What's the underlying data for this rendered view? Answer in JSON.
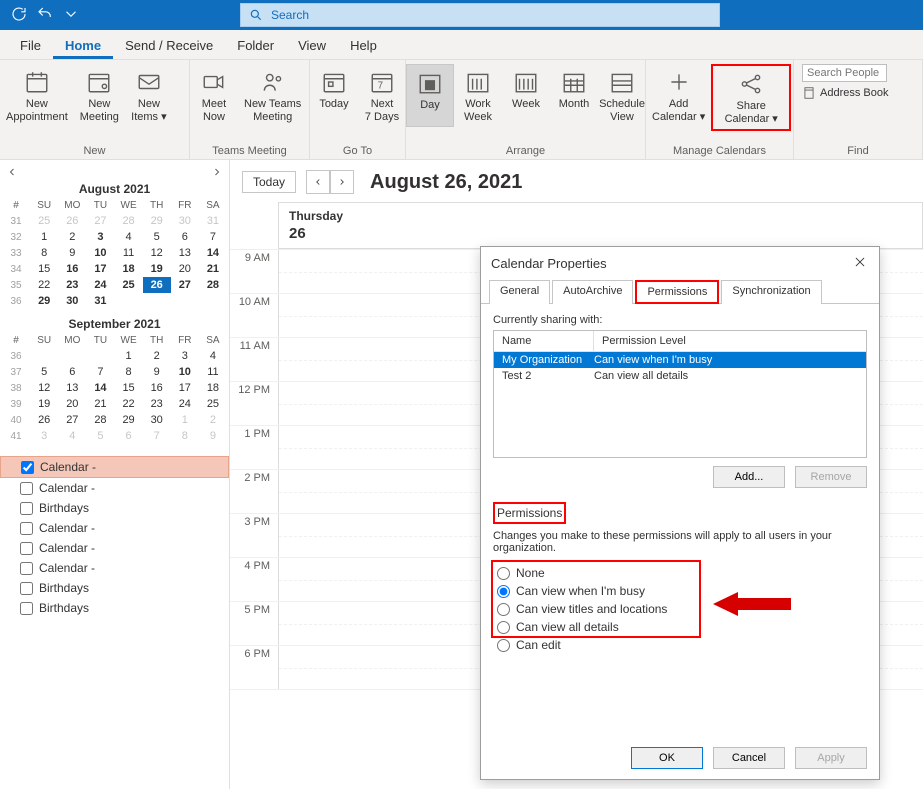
{
  "titlebar": {
    "search_placeholder": "Search"
  },
  "menubar": {
    "file": "File",
    "home": "Home",
    "sendreceive": "Send / Receive",
    "folder": "Folder",
    "view": "View",
    "help": "Help"
  },
  "ribbon": {
    "new_appt": "New\nAppointment",
    "new_meeting": "New\nMeeting",
    "new_items": "New\nItems ▾",
    "meet_now": "Meet\nNow",
    "new_teams": "New Teams\nMeeting",
    "today": "Today",
    "next7": "Next\n7 Days",
    "day": "Day",
    "workweek": "Work\nWeek",
    "week": "Week",
    "month": "Month",
    "schedule": "Schedule\nView",
    "add_cal": "Add\nCalendar ▾",
    "share_cal": "Share\nCalendar ▾",
    "search_people_ph": "Search People",
    "address_book": "Address Book",
    "group_new": "New",
    "group_teams": "Teams Meeting",
    "group_goto": "Go To",
    "group_arrange": "Arrange",
    "group_manage": "Manage Calendars",
    "group_find": "Find"
  },
  "calendars": {
    "aug_title": "August 2021",
    "sep_title": "September 2021",
    "dow": [
      "#",
      "SU",
      "MO",
      "TU",
      "WE",
      "TH",
      "FR",
      "SA"
    ],
    "aug_rows": [
      {
        "wk": "31",
        "d": [
          "25",
          "26",
          "27",
          "28",
          "29",
          "30",
          "31"
        ],
        "prev": true,
        "bold": []
      },
      {
        "wk": "32",
        "d": [
          "1",
          "2",
          "3",
          "4",
          "5",
          "6",
          "7"
        ],
        "bold": [
          "3"
        ]
      },
      {
        "wk": "33",
        "d": [
          "8",
          "9",
          "10",
          "11",
          "12",
          "13",
          "14"
        ],
        "bold": [
          "10",
          "14"
        ]
      },
      {
        "wk": "34",
        "d": [
          "15",
          "16",
          "17",
          "18",
          "19",
          "20",
          "21"
        ],
        "bold": [
          "16",
          "17",
          "18",
          "19",
          "21"
        ]
      },
      {
        "wk": "35",
        "d": [
          "22",
          "23",
          "24",
          "25",
          "26",
          "27",
          "28"
        ],
        "bold": [
          "23",
          "24",
          "25",
          "26",
          "27",
          "28"
        ],
        "today": "26"
      },
      {
        "wk": "36",
        "d": [
          "29",
          "30",
          "31",
          "",
          "",
          "",
          ""
        ],
        "bold": [
          "29",
          "30",
          "31"
        ]
      }
    ],
    "sep_rows": [
      {
        "wk": "36",
        "d": [
          "",
          "",
          "",
          "1",
          "2",
          "3",
          "4"
        ],
        "bold": []
      },
      {
        "wk": "37",
        "d": [
          "5",
          "6",
          "7",
          "8",
          "9",
          "10",
          "11"
        ],
        "bold": [
          "10"
        ]
      },
      {
        "wk": "38",
        "d": [
          "12",
          "13",
          "14",
          "15",
          "16",
          "17",
          "18"
        ],
        "bold": [
          "14"
        ]
      },
      {
        "wk": "39",
        "d": [
          "19",
          "20",
          "21",
          "22",
          "23",
          "24",
          "25"
        ],
        "bold": []
      },
      {
        "wk": "40",
        "d": [
          "26",
          "27",
          "28",
          "29",
          "30",
          "1",
          "2"
        ],
        "bold": [],
        "nprev": [
          "1",
          "2"
        ]
      },
      {
        "wk": "41",
        "d": [
          "3",
          "4",
          "5",
          "6",
          "7",
          "8",
          "9"
        ],
        "prev": true,
        "bold": []
      }
    ],
    "list": [
      "Calendar -",
      "Calendar -",
      "Birthdays",
      "Calendar -",
      "Calendar -",
      "Calendar -",
      "Birthdays",
      "Birthdays"
    ]
  },
  "main": {
    "today_btn": "Today",
    "date_title": "August 26, 2021",
    "day_name": "Thursday",
    "day_num": "26",
    "hours": [
      "9 AM",
      "10 AM",
      "11 AM",
      "12 PM",
      "1 PM",
      "2 PM",
      "3 PM",
      "4 PM",
      "5 PM",
      "6 PM"
    ]
  },
  "dialog": {
    "title": "Calendar Properties",
    "tabs": {
      "general": "General",
      "auto": "AutoArchive",
      "perm": "Permissions",
      "sync": "Synchronization"
    },
    "sharing_label": "Currently sharing with:",
    "col_name": "Name",
    "col_perm": "Permission Level",
    "rows": [
      {
        "name": "My Organization",
        "level": "Can view when I'm busy",
        "selected": true
      },
      {
        "name": "Test 2",
        "level": "Can view all details",
        "selected": false
      }
    ],
    "add_btn": "Add...",
    "remove_btn": "Remove",
    "perm_section": "Permissions",
    "perm_note": "Changes you make to these permissions will apply to all users in your organization.",
    "opts": {
      "none": "None",
      "busy": "Can view when I'm busy",
      "titles": "Can view titles and locations",
      "details": "Can view all details",
      "edit": "Can edit"
    },
    "ok": "OK",
    "cancel": "Cancel",
    "apply": "Apply"
  }
}
